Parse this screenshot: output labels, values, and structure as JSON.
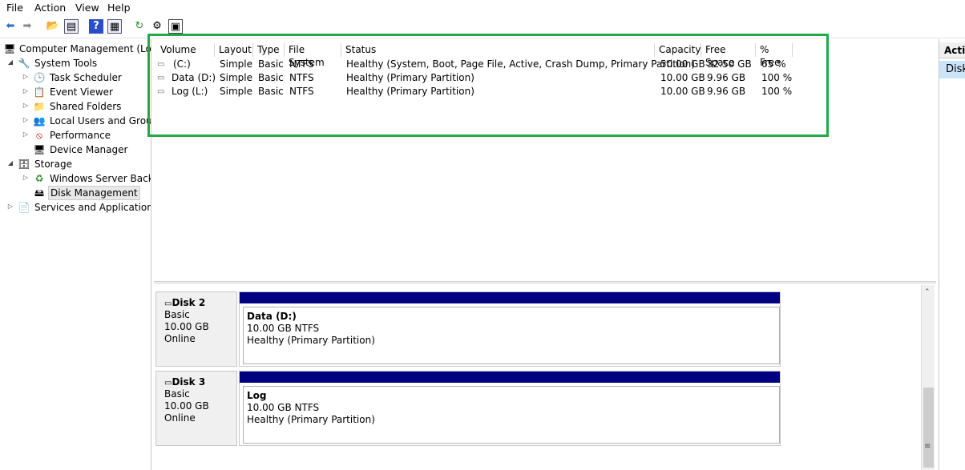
{
  "menu": [
    "File",
    "Action",
    "View",
    "Help"
  ],
  "toolbar_icons": [
    "back-arrow-icon",
    "forward-arrow-icon",
    "up-folder-icon",
    "show-hide-tree-icon",
    "help-icon",
    "properties-icon",
    "refresh-icon",
    "rescan-icon",
    "disk-icon"
  ],
  "tree": {
    "root": "Computer Management (Local",
    "system_tools": "System Tools",
    "task_scheduler": "Task Scheduler",
    "event_viewer": "Event Viewer",
    "shared_folders": "Shared Folders",
    "local_users": "Local Users and Groups",
    "performance": "Performance",
    "device_manager": "Device Manager",
    "storage": "Storage",
    "wsb": "Windows Server Backup",
    "disk_management": "Disk Management",
    "services": "Services and Applications"
  },
  "volumes": {
    "columns": [
      "Volume",
      "Layout",
      "Type",
      "File System",
      "Status",
      "Capacity",
      "Free Space",
      "% Free"
    ],
    "rows": [
      {
        "volume": "(C:)",
        "layout": "Simple",
        "type": "Basic",
        "fs": "NTFS",
        "status": "Healthy (System, Boot, Page File, Active, Crash Dump, Primary Partition)",
        "capacity": "50.00 GB",
        "free": "32.50 GB",
        "pct": "65 %"
      },
      {
        "volume": "Data (D:)",
        "layout": "Simple",
        "type": "Basic",
        "fs": "NTFS",
        "status": "Healthy (Primary Partition)",
        "capacity": "10.00 GB",
        "free": "9.96 GB",
        "pct": "100 %"
      },
      {
        "volume": "Log (L:)",
        "layout": "Simple",
        "type": "Basic",
        "fs": "NTFS",
        "status": "Healthy (Primary Partition)",
        "capacity": "10.00 GB",
        "free": "9.96 GB",
        "pct": "100 %"
      }
    ]
  },
  "disks": [
    {
      "name": "Disk 2",
      "type": "Basic",
      "size": "10.00 GB",
      "state": "Online",
      "part_name": "Data  (D:)",
      "part_size": "10.00 GB NTFS",
      "part_status": "Healthy (Primary Partition)"
    },
    {
      "name": "Disk 3",
      "type": "Basic",
      "size": "10.00 GB",
      "state": "Online",
      "part_name": "Log",
      "part_size": "10.00 GB NTFS",
      "part_status": "Healthy (Primary Partition)"
    }
  ],
  "actions": {
    "header": "Actio",
    "item": "Disk"
  },
  "colors": {
    "highlight": "#22a846",
    "partition_bar": "#000080",
    "selected": "#cce4f7"
  }
}
